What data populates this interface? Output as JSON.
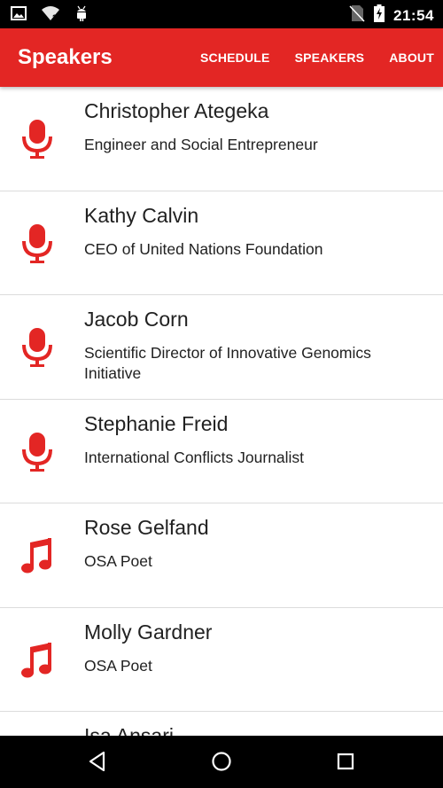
{
  "status_bar": {
    "time": "21:54",
    "icons": [
      "image-icon",
      "wifi-unknown-icon",
      "android-debug-icon",
      "no-sim-icon",
      "battery-charging-icon"
    ]
  },
  "app_bar": {
    "title": "Speakers",
    "tabs": [
      "SCHEDULE",
      "SPEAKERS",
      "ABOUT"
    ]
  },
  "colors": {
    "accent": "#e32624",
    "divider": "#dcdcdc"
  },
  "speakers": [
    {
      "name": "Christopher Ategeka",
      "role": "Engineer and Social Entrepreneur",
      "icon": "microphone-icon"
    },
    {
      "name": "Kathy Calvin",
      "role": "CEO of United Nations Foundation",
      "icon": "microphone-icon"
    },
    {
      "name": "Jacob Corn",
      "role": "Scientific Director of Innovative Genomics Initiative",
      "icon": "microphone-icon"
    },
    {
      "name": "Stephanie Freid",
      "role": "International Conflicts Journalist",
      "icon": "microphone-icon"
    },
    {
      "name": "Rose Gelfand",
      "role": "OSA Poet",
      "icon": "music-note-icon"
    },
    {
      "name": "Molly Gardner",
      "role": "OSA Poet",
      "icon": "music-note-icon"
    },
    {
      "name": "Isa Ansari",
      "role": "",
      "icon": "microphone-icon"
    }
  ],
  "nav_bar": {
    "buttons": [
      "back-icon",
      "home-icon",
      "recents-icon"
    ]
  }
}
